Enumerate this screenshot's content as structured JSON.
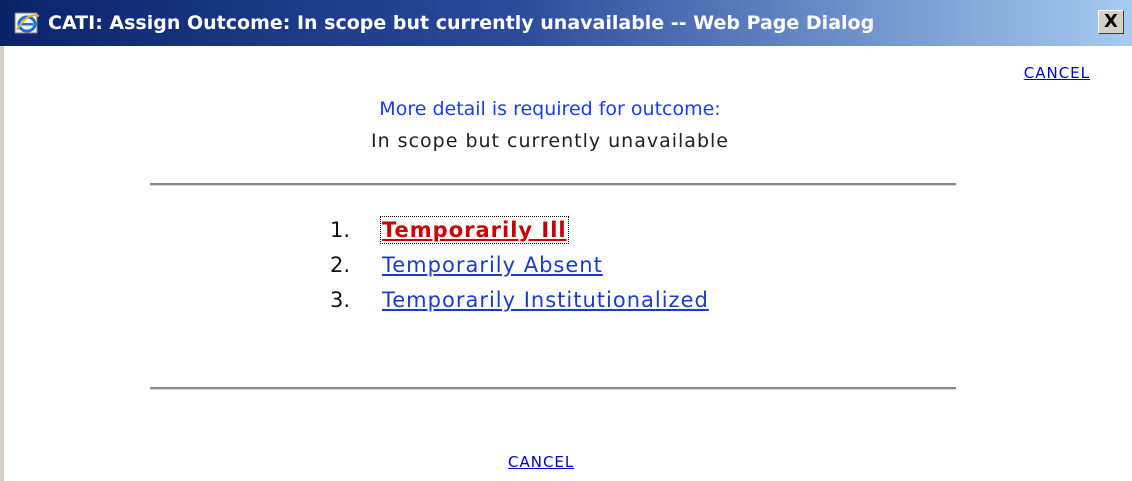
{
  "window": {
    "title": "CATI: Assign Outcome: In scope but currently unavailable -- Web Page Dialog",
    "close_label": "X",
    "icon": "ie-icon"
  },
  "header": {
    "cancel_label": "CANCEL",
    "prompt": "More detail is required for outcome:",
    "outcome": "In scope but currently unavailable"
  },
  "options": [
    {
      "number": "1.",
      "label": "Temporarily Ill",
      "focused": true
    },
    {
      "number": "2.",
      "label": "Temporarily Absent",
      "focused": false
    },
    {
      "number": "3.",
      "label": "Temporarily Institutionalized",
      "focused": false
    }
  ],
  "footer": {
    "cancel_label": "CANCEL"
  },
  "colors": {
    "link": "#1a3cc8",
    "active_link": "#cc0000",
    "title_bar": "#0a246a"
  }
}
